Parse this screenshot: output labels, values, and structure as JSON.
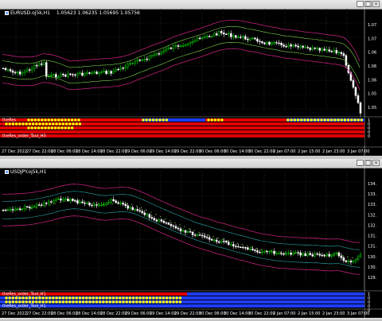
{
  "chart1": {
    "title": "EURUSD.oj5k,H1",
    "ohlc": "1.05623 1.06235 1.05695 1.05756",
    "price_labels": [
      "1.07",
      "1.07",
      "1.06",
      "1.06",
      "1.06",
      "1.05",
      "1.05"
    ],
    "time_labels": [
      "27 Dec 2022",
      "27 Dec 22:00",
      "28 Dec 06:00",
      "28 Dec 14:00",
      "28 Dec 22:00",
      "29 Dec 06:00",
      "29 Dec 14:00",
      "29 Dec 22:00",
      "30 Dec 06:00",
      "30 Dec 14:00",
      "30 Dec 22:00",
      "2 Jan 07:00",
      "2 Jan 15:00",
      "2 Jan 23:00",
      "3 Jan 07:00"
    ],
    "indicator_labels": [
      "theRes",
      "theRes_order_Tool_H0"
    ],
    "indicator_axis": [
      "1",
      "0",
      "0",
      "0",
      "0"
    ]
  },
  "chart2": {
    "title": "USDJPY.oj5k,H1",
    "price_labels": [
      "134.",
      "133.",
      "133.",
      "132.",
      "132.",
      "131.",
      "131.",
      "130.",
      "130.",
      "129."
    ],
    "time_labels": [
      "27 Dec 2022",
      "27 Dec 22:00",
      "28 Dec 06:00",
      "28 Dec 14:00",
      "28 Dec 22:00",
      "29 Dec 06:00",
      "29 Dec 14:00",
      "29 Dec 22:00",
      "30 Dec 06:00",
      "30 Dec 14:00",
      "30 Dec 22:00",
      "2 Jan 07:00",
      "2 Jan 15:00",
      "2 Jan 23:00",
      "3 Jan 07:00"
    ],
    "indicator_labels": [
      "theRes_order_Tool_H1",
      "theRes_order_Tool_H1"
    ],
    "indicator_axis": [
      "1",
      "0",
      "0",
      "0",
      "0"
    ]
  },
  "colors": {
    "background": "#000000",
    "bull_candle": "#00e000",
    "bear_candle": "#ffffff",
    "band_outer": "#c0207a",
    "band_inner": "#7fd64a",
    "band_chart2": "#2aa8a8",
    "indicator_red": "#e00000",
    "indicator_blue": "#1e3cff",
    "indicator_yellow": "#ffff00"
  }
}
